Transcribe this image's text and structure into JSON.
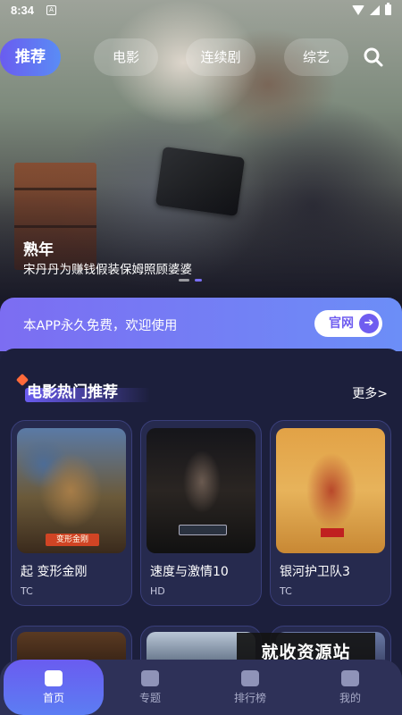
{
  "status": {
    "time": "8:34",
    "notif_icon": "A"
  },
  "tabs": [
    {
      "label": "推荐",
      "active": true
    },
    {
      "label": "电影",
      "active": false
    },
    {
      "label": "连续剧",
      "active": false
    },
    {
      "label": "综艺",
      "active": false
    }
  ],
  "hero": {
    "title": "熟年",
    "subtitle": "宋丹丹为赚钱假装保姆照顾婆婆"
  },
  "banner": {
    "text": "本APP永久免费，欢迎使用",
    "button_label": "官网",
    "button_arrow": "➔"
  },
  "section": {
    "title": "电影热门推荐",
    "more": "更多>"
  },
  "movies": [
    {
      "name": "起   变形金刚",
      "tag": "TC",
      "poster_text": "变形金刚"
    },
    {
      "name": "速度与激情10",
      "tag": "HD"
    },
    {
      "name": "银河护卫队3",
      "tag": "TC"
    }
  ],
  "watermark": "就收资源站",
  "nav": [
    {
      "label": "首页",
      "icon": "home-icon",
      "active": true
    },
    {
      "label": "专题",
      "icon": "topic-icon",
      "active": false
    },
    {
      "label": "排行榜",
      "icon": "ranking-icon",
      "active": false
    },
    {
      "label": "我的",
      "icon": "profile-icon",
      "active": false
    }
  ],
  "colors": {
    "accent": "#6a5cf0",
    "panel_bg": "#1c1f3c",
    "nav_bg": "#2e3158",
    "deco": "#ff6a3a"
  }
}
